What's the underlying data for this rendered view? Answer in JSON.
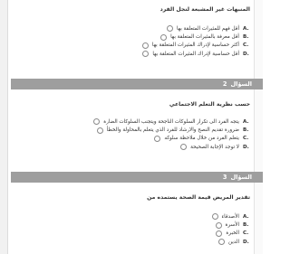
{
  "question1": {
    "text": "المنبهات غير المشبعة لنجل الفرد",
    "options": [
      {
        "letter": "A.",
        "text": "أقل فهم للمثيرات المتعلقة بها"
      },
      {
        "letter": "B.",
        "text": "أقل معرفة بالمثيرات المتعلقة بها"
      },
      {
        "letter": "C.",
        "text": "أكثر حساسية لإدراك المثيرات المتعلقة بها"
      },
      {
        "letter": "D.",
        "text": "أقل حساسية لإدراك المثيرات المتعلقة بها"
      }
    ]
  },
  "question2": {
    "label": "السؤال",
    "number": "2",
    "text": "حسب نظرية التعلم الاجتماعي",
    "options": [
      {
        "letter": "A.",
        "text": "يتجه الفرد الى تكرار السلوكات الناجحة ويتجنب السلوكات الضارة"
      },
      {
        "letter": "B.",
        "text": "ضرورة تقديم النصح والارشاد للفرد الذي يتعلم بالمحاولة والخطأ"
      },
      {
        "letter": "C.",
        "text": "يتعلم الفرد من خلال ملاحظة سلوكه"
      },
      {
        "letter": "D.",
        "text": "لا توجد الإجابة الصحيحة"
      }
    ]
  },
  "question3": {
    "label": "السؤال",
    "number": "3",
    "text": "تقدير المريض قيمة الصحة يستمده من",
    "options": [
      {
        "letter": "A.",
        "text": "الأصدقاء"
      },
      {
        "letter": "B.",
        "text": "الأسرة"
      },
      {
        "letter": "C.",
        "text": "الخبرة"
      },
      {
        "letter": "D.",
        "text": "الدين"
      }
    ]
  }
}
